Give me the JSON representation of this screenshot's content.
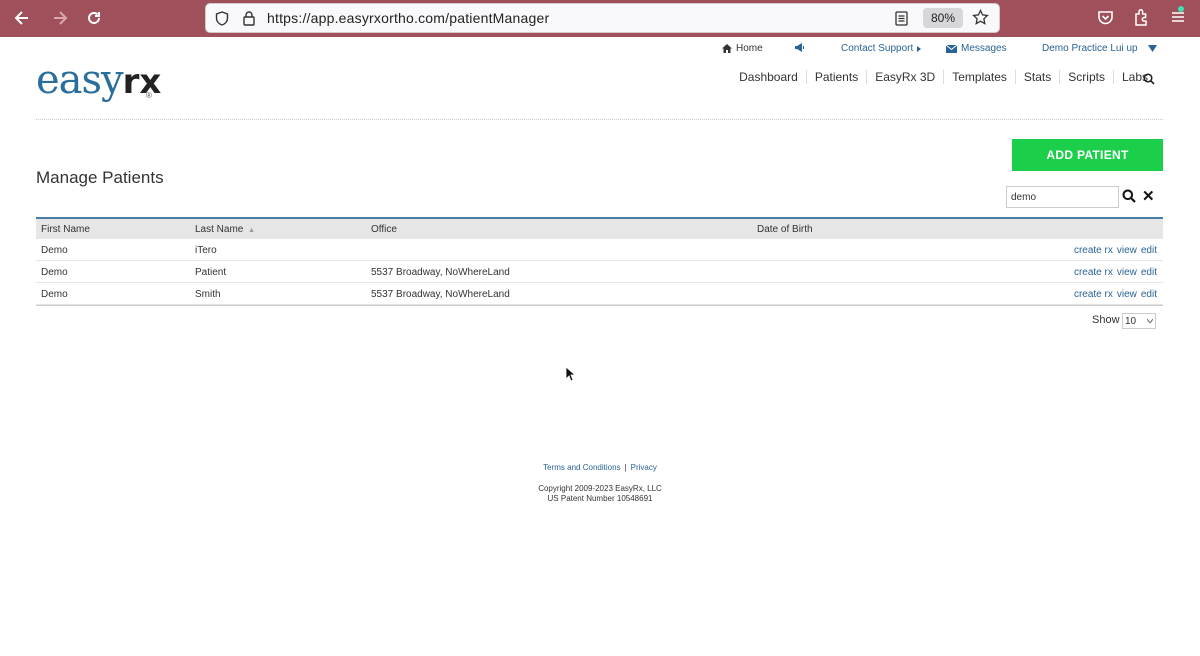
{
  "browser": {
    "url": "https://app.easyrxortho.com/patientManager",
    "zoom": "80%"
  },
  "utility_nav": {
    "home": "Home",
    "contact": "Contact Support",
    "messages": "Messages",
    "account": "Demo Practice Lui up"
  },
  "logo": {
    "part1": "easy",
    "part2": "rx",
    "reg": "®"
  },
  "main_nav": [
    "Dashboard",
    "Patients",
    "EasyRx 3D",
    "Templates",
    "Stats",
    "Scripts",
    "Labs"
  ],
  "page": {
    "title": "Manage Patients",
    "add_button": "ADD PATIENT",
    "search_value": "demo"
  },
  "table": {
    "headers": {
      "first_name": "First Name",
      "last_name": "Last Name",
      "office": "Office",
      "dob": "Date of Birth"
    },
    "rows": [
      {
        "first": "Demo",
        "last": "iTero",
        "office": "",
        "dob": ""
      },
      {
        "first": "Demo",
        "last": "Patient",
        "office": "5537 Broadway, NoWhereLand",
        "dob": ""
      },
      {
        "first": "Demo",
        "last": "Smith",
        "office": "5537 Broadway, NoWhereLand",
        "dob": ""
      }
    ],
    "actions": {
      "create": "create rx",
      "view": "view",
      "edit": "edit"
    }
  },
  "pagination": {
    "show_label": "Show",
    "page_size": "10"
  },
  "footer": {
    "terms": "Terms and Conditions",
    "sep": "|",
    "privacy": "Privacy",
    "copyright": "Copyright 2009-2023 EasyRx, LLC",
    "patent": "US Patent Number 10548691"
  },
  "colors": {
    "browser_bar": "#a0505a",
    "link": "#2a6496",
    "add_button": "#1ccf4a",
    "table_header_border": "#4a7ca8"
  }
}
